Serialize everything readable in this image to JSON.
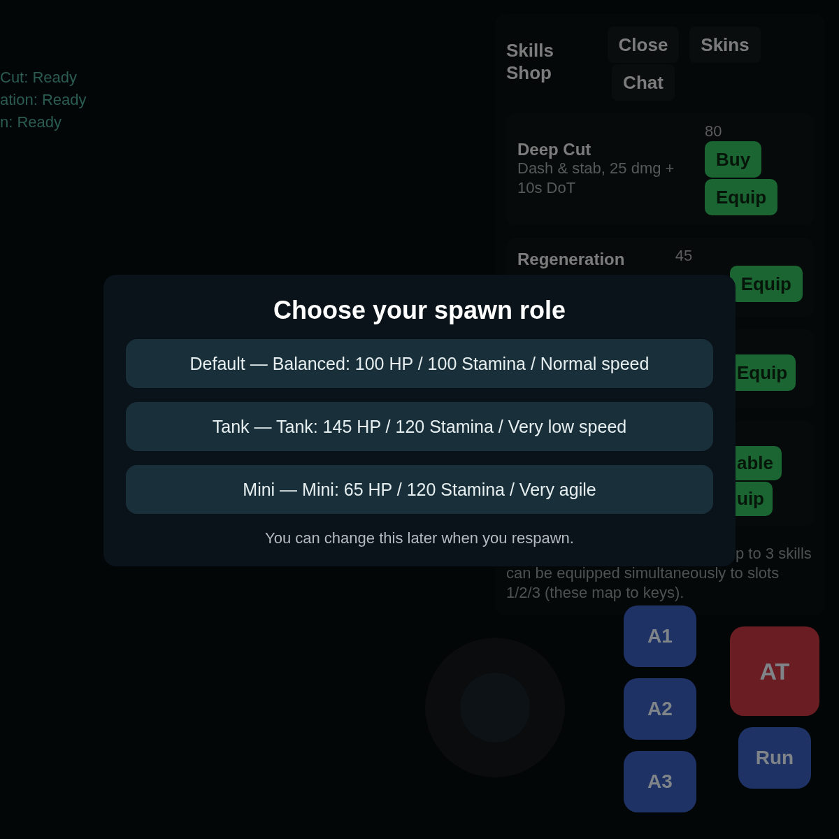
{
  "status_lines": [
    {
      "text": "Cut: Ready"
    },
    {
      "text": "ation: Ready"
    },
    {
      "text": "n: Ready"
    }
  ],
  "shop": {
    "title": "Skills Shop",
    "header_buttons": [
      "Close",
      "Skins",
      "Chat"
    ],
    "skills": [
      {
        "name": "Deep Cut",
        "description": "Dash & stab, 25 dmg + 10s DoT",
        "price": "80",
        "buttons": [
          "Buy",
          "Equip"
        ]
      },
      {
        "name": "Regeneration",
        "price": "45",
        "buttons": [
          "Equip"
        ]
      },
      {
        "buttons": [
          "Equip"
        ]
      },
      {
        "buttons": [
          "able",
          "uip"
        ]
      }
    ],
    "note_lines": [
      "p to 3 skills",
      "can be equipped simultaneously to slots",
      "1/2/3 (these map to keys)."
    ]
  },
  "controls": {
    "ability_buttons": [
      "A1",
      "A2",
      "A3"
    ],
    "attack_button": "AT",
    "run_button": "Run"
  },
  "modal": {
    "title": "Choose your spawn role",
    "roles": [
      {
        "label": "Default — Balanced: 100 HP / 100 Stamina / Normal speed"
      },
      {
        "label": "Tank — Tank: 145 HP / 120 Stamina / Very low speed"
      },
      {
        "label": "Mini — Mini: 65 HP / 120 Stamina / Very agile"
      }
    ],
    "note": "You can change this later when you respawn."
  }
}
